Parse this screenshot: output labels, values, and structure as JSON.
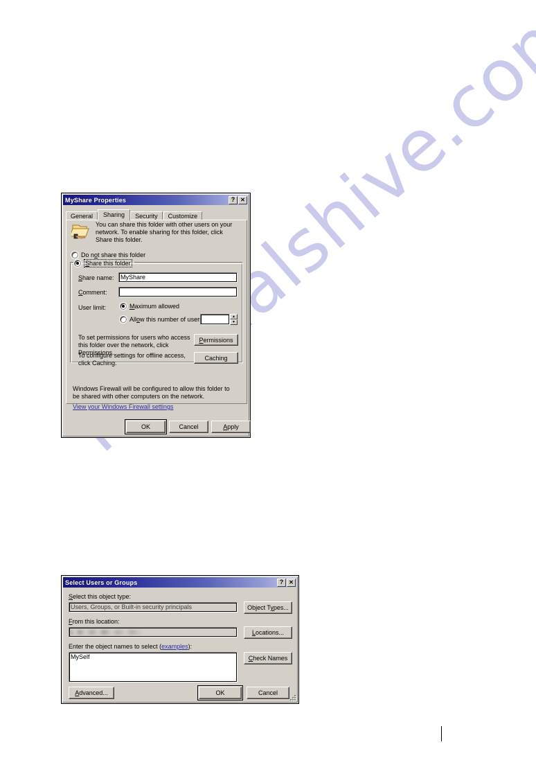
{
  "page": {
    "watermark": "manualshive.com",
    "watermark_color": "#b9b9e8"
  },
  "share_dialog": {
    "title": "MyShare Properties",
    "help_button": "?",
    "close_button": "✕",
    "tabs": [
      {
        "label": "General",
        "active": false
      },
      {
        "label": "Sharing",
        "active": true
      },
      {
        "label": "Security",
        "active": false
      },
      {
        "label": "Customize",
        "active": false
      }
    ],
    "icon": "shared-folder-icon",
    "description": "You can share this folder with other users on your network.  To enable sharing for this folder, click Share this folder.",
    "radio_do_not_share": "Do not share this folder",
    "radio_share": "Share this folder",
    "share_name_label": "Share name:",
    "share_name_value": "MyShare",
    "comment_label": "Comment:",
    "comment_value": "",
    "user_limit_label": "User limit:",
    "radio_maximum_allowed": "Maximum allowed",
    "radio_allow_number": "Allow this number of users:",
    "user_count_value": "",
    "permissions_text": "To set permissions for users who access this folder over the network, click Permissions.",
    "permissions_button": "Permissions",
    "caching_text": "To configure settings for offline access, click Caching.",
    "caching_button": "Caching",
    "firewall_text": "Windows Firewall will be configured to allow this folder to be shared with other computers on the network.",
    "firewall_link": "View your Windows Firewall settings",
    "ok_button": "OK",
    "cancel_button": "Cancel",
    "apply_button": "Apply"
  },
  "select_dialog": {
    "title": "Select Users or Groups",
    "help_button": "?",
    "close_button": "✕",
    "object_type_label": "Select this object type:",
    "object_type_value": "Users, Groups, or Built-in security principals",
    "object_types_button": "Object Types...",
    "location_label": "From this location:",
    "location_value": "",
    "locations_button": "Locations...",
    "object_names_label": "Enter the object names to select (",
    "object_names_link": "examples",
    "object_names_label_end": "):",
    "object_names_value": "MySelf",
    "check_names_button": "Check Names",
    "advanced_button": "Advanced...",
    "ok_button": "OK",
    "cancel_button": "Cancel"
  }
}
